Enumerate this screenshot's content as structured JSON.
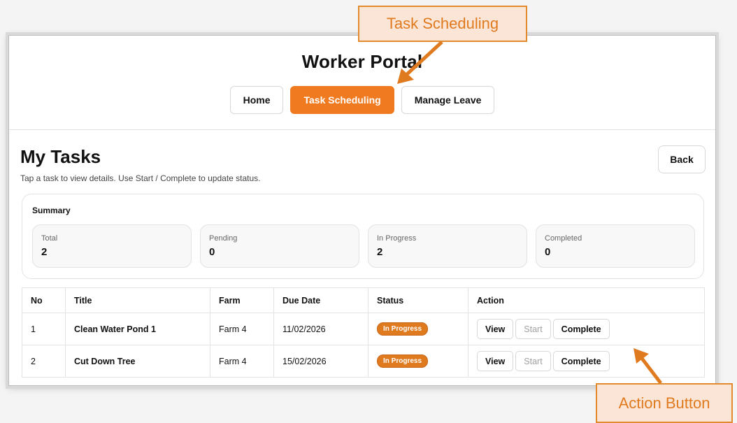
{
  "header": {
    "title": "Worker Portal",
    "nav": [
      {
        "label": "Home",
        "active": false
      },
      {
        "label": "Task Scheduling",
        "active": true
      },
      {
        "label": "Manage Leave",
        "active": false
      }
    ]
  },
  "page": {
    "title": "My Tasks",
    "subtitle": "Tap a task to view details. Use Start / Complete to update status.",
    "back_label": "Back"
  },
  "summary": {
    "label": "Summary",
    "stats": [
      {
        "label": "Total",
        "value": "2"
      },
      {
        "label": "Pending",
        "value": "0"
      },
      {
        "label": "In Progress",
        "value": "2"
      },
      {
        "label": "Completed",
        "value": "0"
      }
    ]
  },
  "table": {
    "columns": [
      "No",
      "Title",
      "Farm",
      "Due Date",
      "Status",
      "Action"
    ],
    "rows": [
      {
        "no": "1",
        "title": "Clean Water Pond 1",
        "farm": "Farm 4",
        "due": "11/02/2026",
        "status": "In Progress"
      },
      {
        "no": "2",
        "title": "Cut Down Tree",
        "farm": "Farm 4",
        "due": "15/02/2026",
        "status": "In Progress"
      }
    ],
    "actions": {
      "view": "View",
      "start": "Start",
      "complete": "Complete"
    }
  },
  "callouts": {
    "top": "Task Scheduling",
    "bottom": "Action Button"
  },
  "colors": {
    "accent": "#f07a1f",
    "callout_fill": "#fbe5d6",
    "callout_border": "#e28a2e"
  }
}
